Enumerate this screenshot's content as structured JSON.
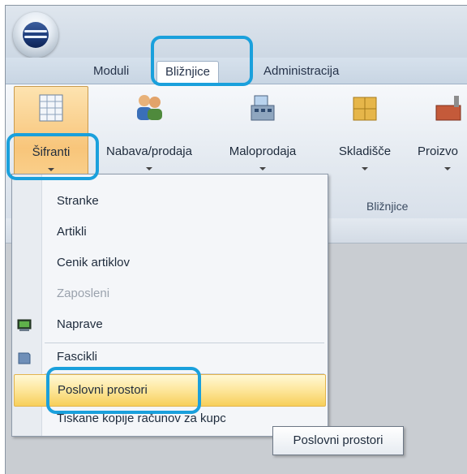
{
  "ribbon_tabs": [
    {
      "label": "Moduli"
    },
    {
      "label": "Bližnjice"
    },
    {
      "label": "Administracija"
    }
  ],
  "ribbon_buttons": [
    {
      "label": "Šifranti",
      "icon": "grid-table-icon"
    },
    {
      "label": "Nabava/prodaja",
      "icon": "people-icon"
    },
    {
      "label": "Maloprodaja",
      "icon": "cash-register-icon"
    },
    {
      "label": "Skladišče",
      "icon": "boxes-icon"
    },
    {
      "label": "Proizvo",
      "icon": "factory-icon"
    }
  ],
  "group_label": "Bližnjice",
  "menu": {
    "items": [
      {
        "label": "Stranke",
        "disabled": false
      },
      {
        "label": "Artikli",
        "disabled": false
      },
      {
        "label": "Cenik artiklov",
        "disabled": false
      },
      {
        "label": "Zaposleni",
        "disabled": true
      },
      {
        "label": "Naprave",
        "disabled": false,
        "icon": "device-icon"
      },
      {
        "label": "Fascikli",
        "disabled": false,
        "icon": "folder-icon"
      },
      {
        "label": "Poslovni prostori",
        "disabled": false,
        "highlighted": true
      },
      {
        "label": "Tiskane kopije računov za kupc",
        "disabled": false
      }
    ]
  },
  "tooltip": "Poslovni prostori",
  "colors": {
    "callout": "#1aa0dc",
    "highlight": "#f7cf5a"
  }
}
